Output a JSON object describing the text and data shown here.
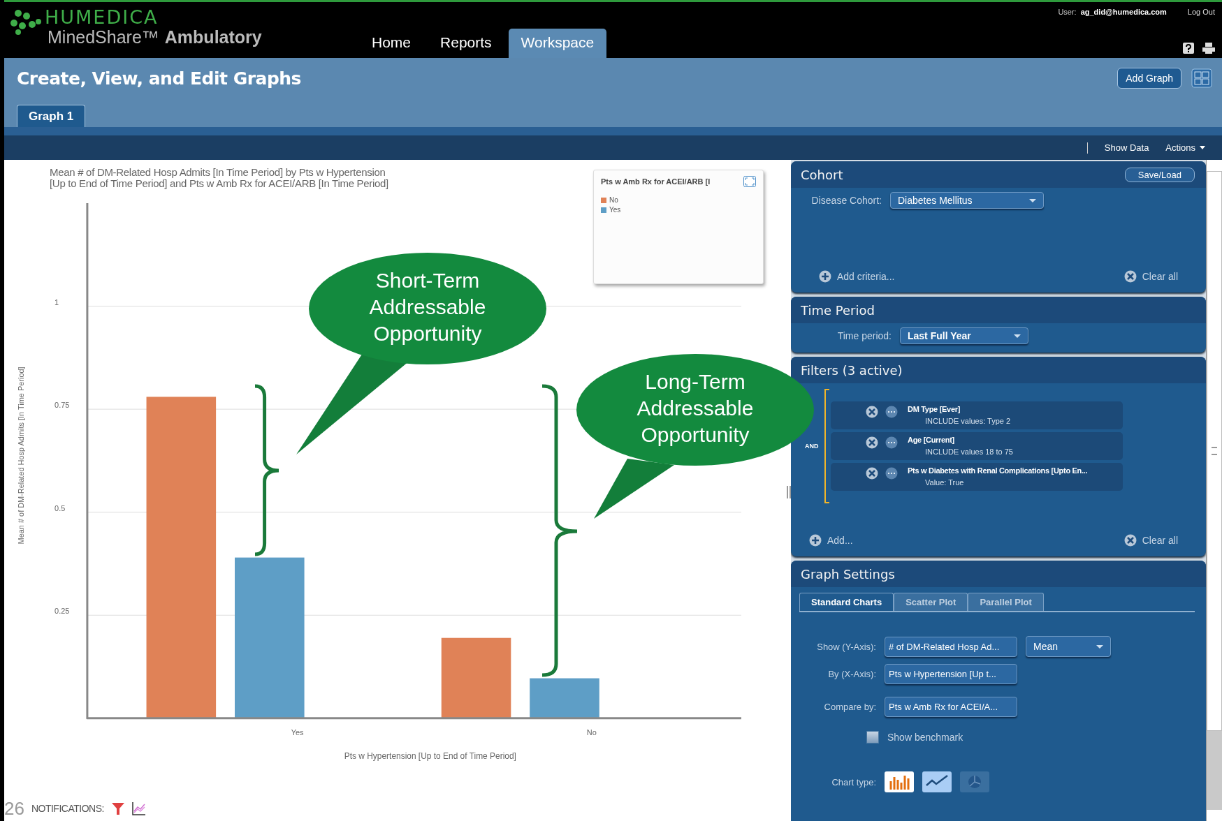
{
  "header": {
    "brand": "HUMEDICA",
    "product": "MinedShare™",
    "product_suffix": "Ambulatory",
    "user_label": "User:",
    "user": "ag_did@humedica.com",
    "logout": "Log Out",
    "nav": [
      {
        "label": "Home",
        "selected": false
      },
      {
        "label": "Reports",
        "selected": false
      },
      {
        "label": "Workspace",
        "selected": true
      }
    ]
  },
  "page": {
    "title": "Create, View, and Edit Graphs",
    "add_button": "Add Graph",
    "tabs": [
      {
        "label": "Graph 1",
        "selected": true
      }
    ]
  },
  "toolbar": {
    "show_data": "Show Data",
    "actions": "Actions"
  },
  "chart": {
    "legend_title": "Pts w Amb Rx for ACEI/ARB [I",
    "chart_data": {
      "type": "bar",
      "grid": true,
      "legend": "upper right",
      "title": "Mean # of DM-Related Hosp Admits [In Time Period] by Pts w Hypertension\n[Up to End of Time Period] and  Pts w Amb Rx for ACEI/ARB [In Time Period]",
      "xlabel": "Pts w Hypertension [Up to End of Time Period]",
      "ylabel": "Mean # of DM-Related Hosp Admits [In Time Period]",
      "categories": [
        "Yes",
        "No"
      ],
      "ylim": [
        0,
        1.25
      ],
      "yticks": [
        0.25,
        0.5,
        {
          "value": 0.75,
          "label": "0.75"
        },
        1
      ],
      "series": [
        {
          "name": "No",
          "color": "#e08257",
          "values": [
            0.78,
            0.195
          ]
        },
        {
          "name": "Yes",
          "color": "#5e9ec6",
          "values": [
            0.39,
            0.097
          ]
        }
      ]
    },
    "callouts": [
      {
        "lines": [
          "Short-Term",
          "Addressable",
          "Opportunity"
        ]
      },
      {
        "lines": [
          "Long-Term",
          "Addressable",
          "Opportunity"
        ]
      }
    ],
    "notifications": "NOTIFICATIONS:",
    "page_number": "26"
  },
  "cohort": {
    "title": "Cohort",
    "save_load": "Save/Load",
    "field_label": "Disease Cohort:",
    "field_value": "Diabetes Mellitus",
    "add": "Add criteria...",
    "clear": "Clear all"
  },
  "time_period": {
    "title": "Time Period",
    "field_label": "Time period:",
    "field_value": "Last Full Year"
  },
  "filters": {
    "title": "Filters (3 active)",
    "operator": "AND",
    "add": "Add...",
    "clear": "Clear all",
    "items": [
      {
        "name": "DM Type [Ever]",
        "detail": "INCLUDE values: Type 2"
      },
      {
        "name": "Age [Current]",
        "detail": "INCLUDE values 18 to 75"
      },
      {
        "name": "Pts w Diabetes with Renal Complications [Upto En...",
        "detail": "Value: True"
      }
    ]
  },
  "graph_settings": {
    "title": "Graph Settings",
    "chart_type_label": "Chart type:",
    "tabs": [
      {
        "label": "Standard Charts",
        "selected": true
      },
      {
        "label": "Scatter Plot",
        "selected": false
      },
      {
        "label": "Parallel Plot",
        "selected": false
      }
    ],
    "fields": [
      {
        "label": "Show (Y-Axis):",
        "value": "# of DM-Related Hosp Ad...",
        "aggregate": "Mean"
      },
      {
        "label": "By (X-Axis):",
        "value": "Pts w Hypertension [Up t..."
      },
      {
        "label": "Compare by:",
        "value": "Pts w Amb Rx for ACEI/A..."
      }
    ],
    "benchmark": {
      "label": "Show benchmark",
      "checked": false
    },
    "chart_types": [
      {
        "kind": "bar",
        "selected": true,
        "highlighted": false
      },
      {
        "kind": "line",
        "selected": false,
        "highlighted": true
      },
      {
        "kind": "pie",
        "selected": false,
        "highlighted": false
      }
    ]
  }
}
